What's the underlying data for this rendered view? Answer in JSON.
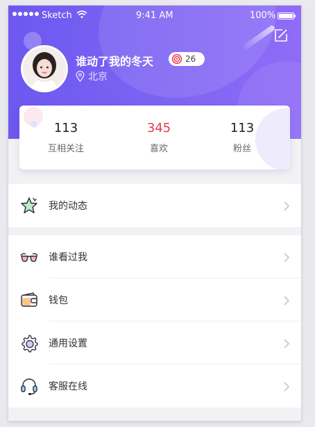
{
  "status_bar": {
    "carrier": "Sketch",
    "time": "9:41 AM",
    "battery": "100%"
  },
  "profile": {
    "name": "谁动了我的冬天",
    "badge_count": "26",
    "location": "北京"
  },
  "stats": [
    {
      "value": "113",
      "label": "互相关注"
    },
    {
      "value": "345",
      "label": "喜欢"
    },
    {
      "value": "113",
      "label": "粉丝"
    }
  ],
  "menu_group1": [
    {
      "label": "我的动态",
      "icon": "star-icon"
    }
  ],
  "menu_group2": [
    {
      "label": "谁看过我",
      "icon": "glasses-icon"
    },
    {
      "label": "钱包",
      "icon": "wallet-icon"
    },
    {
      "label": "通用设置",
      "icon": "gear-icon"
    },
    {
      "label": "客服在线",
      "icon": "headset-icon"
    }
  ],
  "colors": {
    "accent_start": "#6d58f0",
    "accent_end": "#8f6cf7",
    "likes_red": "#e8384e"
  }
}
